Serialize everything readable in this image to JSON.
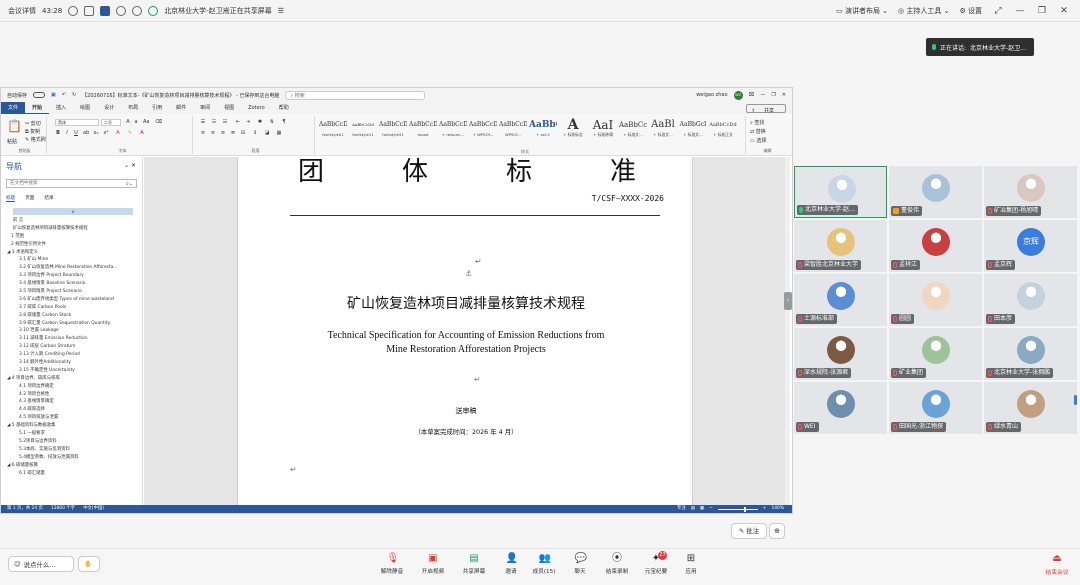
{
  "meeting": {
    "info_label": "会议详情",
    "timer": "43:28",
    "screen_share_notice": "北京林业大学-赵卫嵩正在共享屏幕",
    "presenter_layout": "演讲者布局",
    "host_tools": "主持人工具",
    "settings": "设置",
    "speaking_label": "正在讲话:",
    "speaking_name": "北京林业大学-赵卫..."
  },
  "word": {
    "autosave": "自动保存",
    "doc_title": "【20260716】标准文本-《矿山恢复造林项目减排量核算技术规程》 - 已保存到这台电脑",
    "search_placeholder": "搜索",
    "user_name": "weigao zhao",
    "user_initials": "WZ",
    "tabs": [
      "文件",
      "开始",
      "插入",
      "绘图",
      "设计",
      "布局",
      "引用",
      "邮件",
      "审阅",
      "视图",
      "Zotero",
      "帮助"
    ],
    "share_label": "共享",
    "clipboard": {
      "paste": "粘贴",
      "cut": "剪切",
      "copy": "复制",
      "format_painter": "格式刷",
      "group": "剪贴板"
    },
    "font": {
      "font_name": "黑体",
      "font_size": "二号",
      "group": "字体"
    },
    "paragraph_group": "段落",
    "styles_group": "样式",
    "styles": [
      {
        "sample": "AaBbCcDd",
        "name": "fontstyle01"
      },
      {
        "sample": "AaBbCcDd",
        "name": "fontstyle11"
      },
      {
        "sample": "AaBbCcDi",
        "name": "fontstyle31"
      },
      {
        "sample": "AaBbCcD",
        "name": "mood"
      },
      {
        "sample": "AaBbCcDc",
        "name": "+ resourc..."
      },
      {
        "sample": "AaBbCcDd",
        "name": "+ WPSOf..."
      },
      {
        "sample": "AaBbCcDd",
        "name": "WPSOf..."
      },
      {
        "sample": "AaBbC",
        "name": "+ xel-2"
      },
      {
        "sample": "A",
        "name": "+ 标准标志"
      },
      {
        "sample": "AaI",
        "name": "+ 标准称谓"
      },
      {
        "sample": "AaBbCcI",
        "name": "+ 标准文..."
      },
      {
        "sample": "AaBl",
        "name": "+ 标准文..."
      },
      {
        "sample": "AaBbGcI",
        "name": "+ 标准文..."
      },
      {
        "sample": "AaBbCcDd",
        "name": "+ 标准正文"
      }
    ],
    "editing": {
      "find": "查找",
      "replace": "替换",
      "select": "选择",
      "group": "编辑"
    }
  },
  "nav": {
    "title": "导航",
    "search_placeholder": "在文档中搜索",
    "tabs": [
      "标题",
      "页面",
      "结果"
    ],
    "selected": "x",
    "items": [
      "前  言",
      "矿山恢复造林项目减排量核算技术规程",
      "1 范围",
      "2 规范性引用文件",
      "◢ 3 术语和定义",
      "3.1 矿山 Mine",
      "3.2 矿山恢复造林 Mine Restoration Afforesta...",
      "3.3 项目边界 Project Boundary",
      "3.4 基线情景 Baseline Scenario",
      "3.5 项目情景 Project Scenario",
      "3.6 矿山废弃地类型 Types of mine wasteland",
      "3.7 碳库 Carbon Pools",
      "3.8 碳储量 Carbon Stock",
      "3.9 碳汇量 Carbon Sequestration Quantity",
      "3.10 泄漏 Leakage",
      "3.11 减排量 Emission Reduction",
      "3.12 碳层 Carbon Stratum",
      "3.13 计入期 Crediting Period",
      "3.14 额外性Additionality",
      "3.15 不确定性 Uncertainty",
      "◢ 4 项目边界、碳库与排库",
      "4.1 项目边界确定",
      "4.2 项目合格性",
      "4.3 基线情景确定",
      "4.4 碳库选择",
      "4.5 项目排放与泄漏",
      "◢ 5 基础资料与数据收集",
      "5.1 一般要求",
      "5.2项目与边界资料",
      "5.3本底、实施与监测资料",
      "5.4模型参数、排放与泄漏资料",
      "◢ 6 碳储量核算",
      "6.1 碳汇储量"
    ]
  },
  "document": {
    "big_head_chars": [
      "团",
      "体",
      "标",
      "准"
    ],
    "std_code": "T/CSF—XXXX-2026",
    "title_cn": "矿山恢复造林项目减排量核算技术规程",
    "title_en_line1": "Technical Specification for Accounting of Emission Reductions from",
    "title_en_line2": "Mine Restoration Afforestation Projects",
    "draft_label": "送审稿",
    "finish_time": "（本草案完成时间：2026 年 4 月）"
  },
  "statusbar": {
    "page": "第 1 页，共 24 页",
    "words": "12860 个字",
    "lang": "中文(中国)",
    "focus": "专注",
    "zoom": "140%"
  },
  "participants": [
    {
      "name": "北京林业大学-赵...",
      "avatar": "",
      "mic": "active",
      "speaking": true
    },
    {
      "name": "董俊伟",
      "avatar": "",
      "mic": "host",
      "speaking": false
    },
    {
      "name": "矿冶集团-杨旭晴",
      "avatar": "",
      "mic": "off",
      "speaking": false
    },
    {
      "name": "梁智胜北京林业大学",
      "avatar": "",
      "mic": "off",
      "speaking": false
    },
    {
      "name": "孟祥江",
      "avatar": "",
      "mic": "off",
      "speaking": false
    },
    {
      "name": "孟京辉",
      "avatar": "京辉",
      "mic": "off",
      "speaking": false
    },
    {
      "name": "土源标准部",
      "avatar": "",
      "mic": "off",
      "speaking": false
    },
    {
      "name": "圆圆",
      "avatar": "",
      "mic": "off",
      "speaking": false
    },
    {
      "name": "田本彦",
      "avatar": "",
      "mic": "off",
      "speaking": false
    },
    {
      "name": "深水规院-张源君",
      "avatar": "",
      "mic": "off",
      "speaking": false
    },
    {
      "name": "矿业集团",
      "avatar": "",
      "mic": "off",
      "speaking": false
    },
    {
      "name": "北京林业大学-张拥鹏",
      "avatar": "",
      "mic": "off",
      "speaking": false
    },
    {
      "name": "WEI",
      "avatar": "",
      "mic": "off",
      "speaking": false
    },
    {
      "name": "田国光-浙江物探",
      "avatar": "",
      "mic": "off",
      "speaking": false
    },
    {
      "name": "绿水青山",
      "avatar": "",
      "mic": "off",
      "speaking": false
    }
  ],
  "controls": {
    "annotate": "批注",
    "say_something": "说点什么...",
    "mute": "解除静音",
    "video": "开启视频",
    "share": "共享屏幕",
    "invite": "邀请",
    "members": "成员(15)",
    "chat": "聊天",
    "record": "结束录制",
    "ai_minutes": "元宝纪要",
    "ai_badge": "23",
    "apps": "应用",
    "end": "结束会议"
  },
  "colors": {
    "word_blue": "#2b579a",
    "speaking_green": "#18a058",
    "end_red": "#e53935"
  }
}
